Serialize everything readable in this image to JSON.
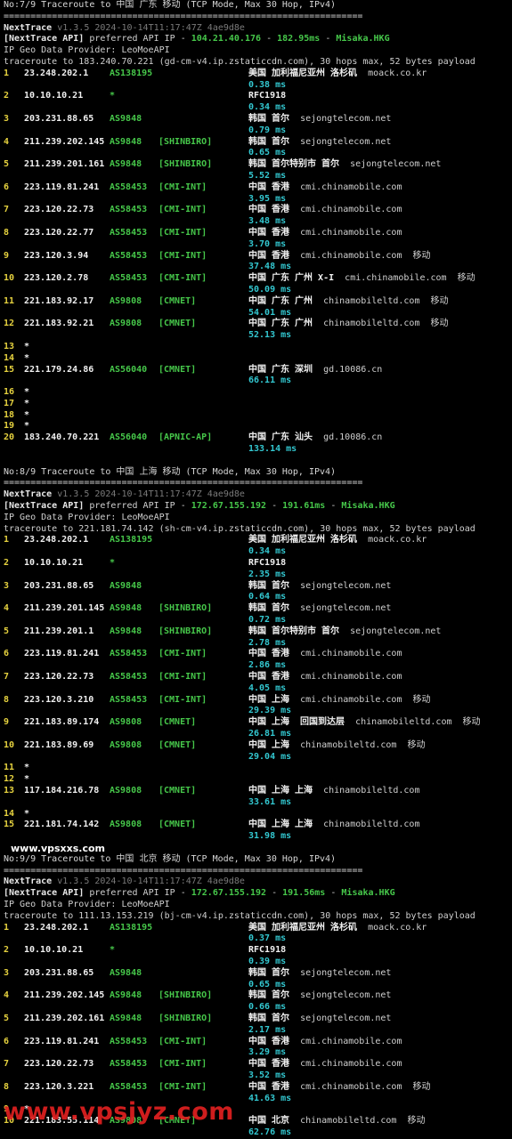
{
  "sections": [
    {
      "title": "No:7/9 Traceroute to 中国 广东 移动 (TCP Mode, Max 30 Hop, IPv4)",
      "separator": "===================================================================",
      "app_name": "NextTrace",
      "app_version": "v1.3.5 2024-10-14T11:17:47Z 4ae9d8e",
      "api_prefix": "[NextTrace API]",
      "api_text": "preferred API IP -",
      "api_ip": "104.21.40.176",
      "api_sep": "-",
      "api_ms": "182.95ms",
      "api_sep2": "-",
      "api_node": "Misaka.HKG",
      "geo_provider": "IP Geo Data Provider: LeoMoeAPI",
      "trace_line": "traceroute to 183.240.70.221 (gd-cm-v4.ip.zstaticcdn.com), 30 hops max, 52 bytes payload",
      "hops": [
        {
          "n": "1",
          "ip": "23.248.202.1",
          "asn": "AS138195",
          "tag": "",
          "geo": "美国 加利福尼亚州 洛杉矶",
          "host": "moack.co.kr",
          "extra": "",
          "rtt": "0.38 ms"
        },
        {
          "n": "2",
          "ip": "10.10.10.21",
          "asn": "*",
          "tag": "",
          "geo": "RFC1918",
          "host": "",
          "extra": "",
          "rtt": "0.34 ms"
        },
        {
          "n": "3",
          "ip": "203.231.88.65",
          "asn": "AS9848",
          "tag": "",
          "geo": "韩国 首尔",
          "host": "sejongtelecom.net",
          "extra": "",
          "rtt": "0.79 ms"
        },
        {
          "n": "4",
          "ip": "211.239.202.145",
          "asn": "AS9848",
          "tag": "[SHINBIRO]",
          "geo": "韩国 首尔",
          "host": "sejongtelecom.net",
          "extra": "",
          "rtt": "0.65 ms"
        },
        {
          "n": "5",
          "ip": "211.239.201.161",
          "asn": "AS9848",
          "tag": "[SHINBIRO]",
          "geo": "韩国 首尔特别市 首尔",
          "host": "sejongtelecom.net",
          "extra": "",
          "rtt": "5.52 ms"
        },
        {
          "n": "6",
          "ip": "223.119.81.241",
          "asn": "AS58453",
          "tag": "[CMI-INT]",
          "geo": "中国 香港",
          "host": "cmi.chinamobile.com",
          "extra": "",
          "rtt": "3.95 ms"
        },
        {
          "n": "7",
          "ip": "223.120.22.73",
          "asn": "AS58453",
          "tag": "[CMI-INT]",
          "geo": "中国 香港",
          "host": "cmi.chinamobile.com",
          "extra": "",
          "rtt": "3.48 ms"
        },
        {
          "n": "8",
          "ip": "223.120.22.77",
          "asn": "AS58453",
          "tag": "[CMI-INT]",
          "geo": "中国 香港",
          "host": "cmi.chinamobile.com",
          "extra": "",
          "rtt": "3.70 ms"
        },
        {
          "n": "9",
          "ip": "223.120.3.94",
          "asn": "AS58453",
          "tag": "[CMI-INT]",
          "geo": "中国 香港",
          "host": "cmi.chinamobile.com",
          "extra": "移动",
          "rtt": "37.48 ms"
        },
        {
          "n": "10",
          "ip": "223.120.2.78",
          "asn": "AS58453",
          "tag": "[CMI-INT]",
          "geo": "中国 广东 广州 X-I",
          "host": "cmi.chinamobile.com",
          "extra": "移动",
          "rtt": "50.09 ms"
        },
        {
          "n": "11",
          "ip": "221.183.92.17",
          "asn": "AS9808",
          "tag": "[CMNET]",
          "geo": "中国 广东 广州",
          "host": "chinamobileltd.com",
          "extra": "移动",
          "rtt": "54.01 ms"
        },
        {
          "n": "12",
          "ip": "221.183.92.21",
          "asn": "AS9808",
          "tag": "[CMNET]",
          "geo": "中国 广东 广州",
          "host": "chinamobileltd.com",
          "extra": "移动",
          "rtt": "52.13 ms"
        },
        {
          "n": "13",
          "star": true
        },
        {
          "n": "14",
          "star": true
        },
        {
          "n": "15",
          "ip": "221.179.24.86",
          "asn": "AS56040",
          "tag": "[CMNET]",
          "geo": "中国 广东 深圳",
          "host": "gd.10086.cn",
          "extra": "",
          "rtt": "66.11 ms"
        },
        {
          "n": "16",
          "star": true
        },
        {
          "n": "17",
          "star": true
        },
        {
          "n": "18",
          "star": true
        },
        {
          "n": "19",
          "star": true
        },
        {
          "n": "20",
          "ip": "183.240.70.221",
          "asn": "AS56040",
          "tag": "[APNIC-AP]",
          "geo": "中国 广东 汕头",
          "host": "gd.10086.cn",
          "extra": "",
          "rtt": "133.14 ms"
        }
      ]
    },
    {
      "title": "No:8/9 Traceroute to 中国 上海 移动 (TCP Mode, Max 30 Hop, IPv4)",
      "separator": "===================================================================",
      "app_name": "NextTrace",
      "app_version": "v1.3.5 2024-10-14T11:17:47Z 4ae9d8e",
      "api_prefix": "[NextTrace API]",
      "api_text": "preferred API IP -",
      "api_ip": "172.67.155.192",
      "api_sep": "-",
      "api_ms": "191.61ms",
      "api_sep2": "-",
      "api_node": "Misaka.HKG",
      "geo_provider": "IP Geo Data Provider: LeoMoeAPI",
      "trace_line": "traceroute to 221.181.74.142 (sh-cm-v4.ip.zstaticcdn.com), 30 hops max, 52 bytes payload",
      "hops": [
        {
          "n": "1",
          "ip": "23.248.202.1",
          "asn": "AS138195",
          "tag": "",
          "geo": "美国 加利福尼亚州 洛杉矶",
          "host": "moack.co.kr",
          "extra": "",
          "rtt": "0.34 ms"
        },
        {
          "n": "2",
          "ip": "10.10.10.21",
          "asn": "*",
          "tag": "",
          "geo": "RFC1918",
          "host": "",
          "extra": "",
          "rtt": "2.35 ms"
        },
        {
          "n": "3",
          "ip": "203.231.88.65",
          "asn": "AS9848",
          "tag": "",
          "geo": "韩国 首尔",
          "host": "sejongtelecom.net",
          "extra": "",
          "rtt": "0.64 ms"
        },
        {
          "n": "4",
          "ip": "211.239.201.145",
          "asn": "AS9848",
          "tag": "[SHINBIRO]",
          "geo": "韩国 首尔",
          "host": "sejongtelecom.net",
          "extra": "",
          "rtt": "0.72 ms"
        },
        {
          "n": "5",
          "ip": "211.239.201.1",
          "asn": "AS9848",
          "tag": "[SHINBIRO]",
          "geo": "韩国 首尔特别市 首尔",
          "host": "sejongtelecom.net",
          "extra": "",
          "rtt": "2.78 ms"
        },
        {
          "n": "6",
          "ip": "223.119.81.241",
          "asn": "AS58453",
          "tag": "[CMI-INT]",
          "geo": "中国 香港",
          "host": "cmi.chinamobile.com",
          "extra": "",
          "rtt": "2.86 ms"
        },
        {
          "n": "7",
          "ip": "223.120.22.73",
          "asn": "AS58453",
          "tag": "[CMI-INT]",
          "geo": "中国 香港",
          "host": "cmi.chinamobile.com",
          "extra": "",
          "rtt": "4.05 ms"
        },
        {
          "n": "8",
          "ip": "223.120.3.210",
          "asn": "AS58453",
          "tag": "[CMI-INT]",
          "geo": "中国 上海",
          "host": "cmi.chinamobile.com",
          "extra": "移动",
          "rtt": "29.39 ms"
        },
        {
          "n": "9",
          "ip": "221.183.89.174",
          "asn": "AS9808",
          "tag": "[CMNET]",
          "geo": "中国 上海  回国到达层",
          "host": "chinamobileltd.com",
          "extra": "移动",
          "rtt": "26.81 ms"
        },
        {
          "n": "10",
          "ip": "221.183.89.69",
          "asn": "AS9808",
          "tag": "[CMNET]",
          "geo": "中国 上海",
          "host": "chinamobileltd.com",
          "extra": "移动",
          "rtt": "29.04 ms"
        },
        {
          "n": "11",
          "star": true
        },
        {
          "n": "12",
          "star": true
        },
        {
          "n": "13",
          "ip": "117.184.216.78",
          "asn": "AS9808",
          "tag": "[CMNET]",
          "geo": "中国 上海 上海",
          "host": "chinamobileltd.com",
          "extra": "",
          "rtt": "33.61 ms"
        },
        {
          "n": "14",
          "star": true
        },
        {
          "n": "15",
          "ip": "221.181.74.142",
          "asn": "AS9808",
          "tag": "[CMNET]",
          "geo": "中国 上海 上海",
          "host": "chinamobileltd.com",
          "extra": "",
          "rtt": "31.98 ms"
        }
      ]
    },
    {
      "title": "No:9/9 Traceroute to 中国 北京 移动 (TCP Mode, Max 30 Hop, IPv4)",
      "separator": "===================================================================",
      "app_name": "NextTrace",
      "app_version": "v1.3.5 2024-10-14T11:17:47Z 4ae9d8e",
      "api_prefix": "[NextTrace API]",
      "api_text": "preferred API IP -",
      "api_ip": "172.67.155.192",
      "api_sep": "-",
      "api_ms": "191.56ms",
      "api_sep2": "-",
      "api_node": "Misaka.HKG",
      "geo_provider": "IP Geo Data Provider: LeoMoeAPI",
      "trace_line": "traceroute to 111.13.153.219 (bj-cm-v4.ip.zstaticcdn.com), 30 hops max, 52 bytes payload",
      "hops": [
        {
          "n": "1",
          "ip": "23.248.202.1",
          "asn": "AS138195",
          "tag": "",
          "geo": "美国 加利福尼亚州 洛杉矶",
          "host": "moack.co.kr",
          "extra": "",
          "rtt": "0.37 ms"
        },
        {
          "n": "2",
          "ip": "10.10.10.21",
          "asn": "*",
          "tag": "",
          "geo": "RFC1918",
          "host": "",
          "extra": "",
          "rtt": "0.39 ms"
        },
        {
          "n": "3",
          "ip": "203.231.88.65",
          "asn": "AS9848",
          "tag": "",
          "geo": "韩国 首尔",
          "host": "sejongtelecom.net",
          "extra": "",
          "rtt": "0.65 ms"
        },
        {
          "n": "4",
          "ip": "211.239.202.145",
          "asn": "AS9848",
          "tag": "[SHINBIRO]",
          "geo": "韩国 首尔",
          "host": "sejongtelecom.net",
          "extra": "",
          "rtt": "0.66 ms"
        },
        {
          "n": "5",
          "ip": "211.239.202.161",
          "asn": "AS9848",
          "tag": "[SHINBIRO]",
          "geo": "韩国 首尔",
          "host": "sejongtelecom.net",
          "extra": "",
          "rtt": "2.17 ms"
        },
        {
          "n": "6",
          "ip": "223.119.81.241",
          "asn": "AS58453",
          "tag": "[CMI-INT]",
          "geo": "中国 香港",
          "host": "cmi.chinamobile.com",
          "extra": "",
          "rtt": "3.29 ms"
        },
        {
          "n": "7",
          "ip": "223.120.22.73",
          "asn": "AS58453",
          "tag": "[CMI-INT]",
          "geo": "中国 香港",
          "host": "cmi.chinamobile.com",
          "extra": "",
          "rtt": "3.52 ms"
        },
        {
          "n": "8",
          "ip": "223.120.3.221",
          "asn": "AS58453",
          "tag": "[CMI-INT]",
          "geo": "中国 香港",
          "host": "cmi.chinamobile.com",
          "extra": "移动",
          "rtt": "41.63 ms"
        },
        {
          "n": "9",
          "star": true
        },
        {
          "n": "10",
          "ip": "221.183.55.114",
          "asn": "AS9808",
          "tag": "[CMNET]",
          "geo": "中国 北京",
          "host": "chinamobileltd.com",
          "extra": "移动",
          "rtt": "62.76 ms"
        }
      ]
    }
  ],
  "watermark_top": "www.vpsxxs.com",
  "watermark_bottom": "www.vpsjyz.com"
}
